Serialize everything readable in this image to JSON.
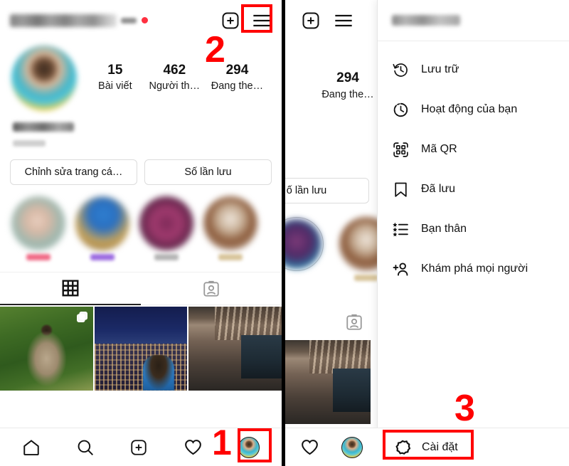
{
  "left_panel": {
    "header": {
      "username_hidden": true,
      "live_dot_color": "#ff3040",
      "add_icon": "plus-box-icon",
      "menu_icon": "hamburger-menu-icon"
    },
    "stats": [
      {
        "value": "15",
        "label": "Bài viết"
      },
      {
        "value": "462",
        "label": "Người th…"
      },
      {
        "value": "294",
        "label": "Đang the…"
      }
    ],
    "actions": [
      {
        "label": "Chỉnh sửa trang cá…"
      },
      {
        "label": "Số lần lưu"
      }
    ],
    "tabs": [
      {
        "name": "grid-tab",
        "active": true
      },
      {
        "name": "tagged-tab",
        "active": false
      }
    ],
    "highlights_count": 4
  },
  "right_panel": {
    "stats": [
      {
        "value": "294",
        "label": "Đang the…"
      }
    ],
    "actions": [
      {
        "label": "ố lần lưu"
      }
    ],
    "menu": {
      "items": [
        {
          "icon": "archive-clock-icon",
          "label": "Lưu trữ"
        },
        {
          "icon": "activity-clock-icon",
          "label": "Hoạt động của bạn"
        },
        {
          "icon": "qr-code-icon",
          "label": "Mã QR"
        },
        {
          "icon": "bookmark-icon",
          "label": "Đã lưu"
        },
        {
          "icon": "star-list-icon",
          "label": "Bạn thân"
        },
        {
          "icon": "add-person-icon",
          "label": "Khám phá mọi người"
        }
      ],
      "footer": {
        "icon": "gear-icon",
        "label": "Cài đặt"
      }
    }
  },
  "bottom_nav": {
    "items": [
      {
        "icon": "home-icon",
        "label": "Trang chủ"
      },
      {
        "icon": "search-icon",
        "label": "Tìm kiếm"
      },
      {
        "icon": "plus-box-icon",
        "label": "Tạo mới"
      },
      {
        "icon": "heart-icon",
        "label": "Hoạt động"
      },
      {
        "icon": "profile-avatar-icon",
        "label": "Trang cá nhân"
      }
    ]
  },
  "annotations": [
    {
      "number": "1",
      "target": "profile-avatar-nav-item",
      "color": "#ff0000"
    },
    {
      "number": "2",
      "target": "hamburger-menu-icon",
      "color": "#ff0000"
    },
    {
      "number": "3",
      "target": "settings-menu-item",
      "color": "#ff0000"
    }
  ]
}
